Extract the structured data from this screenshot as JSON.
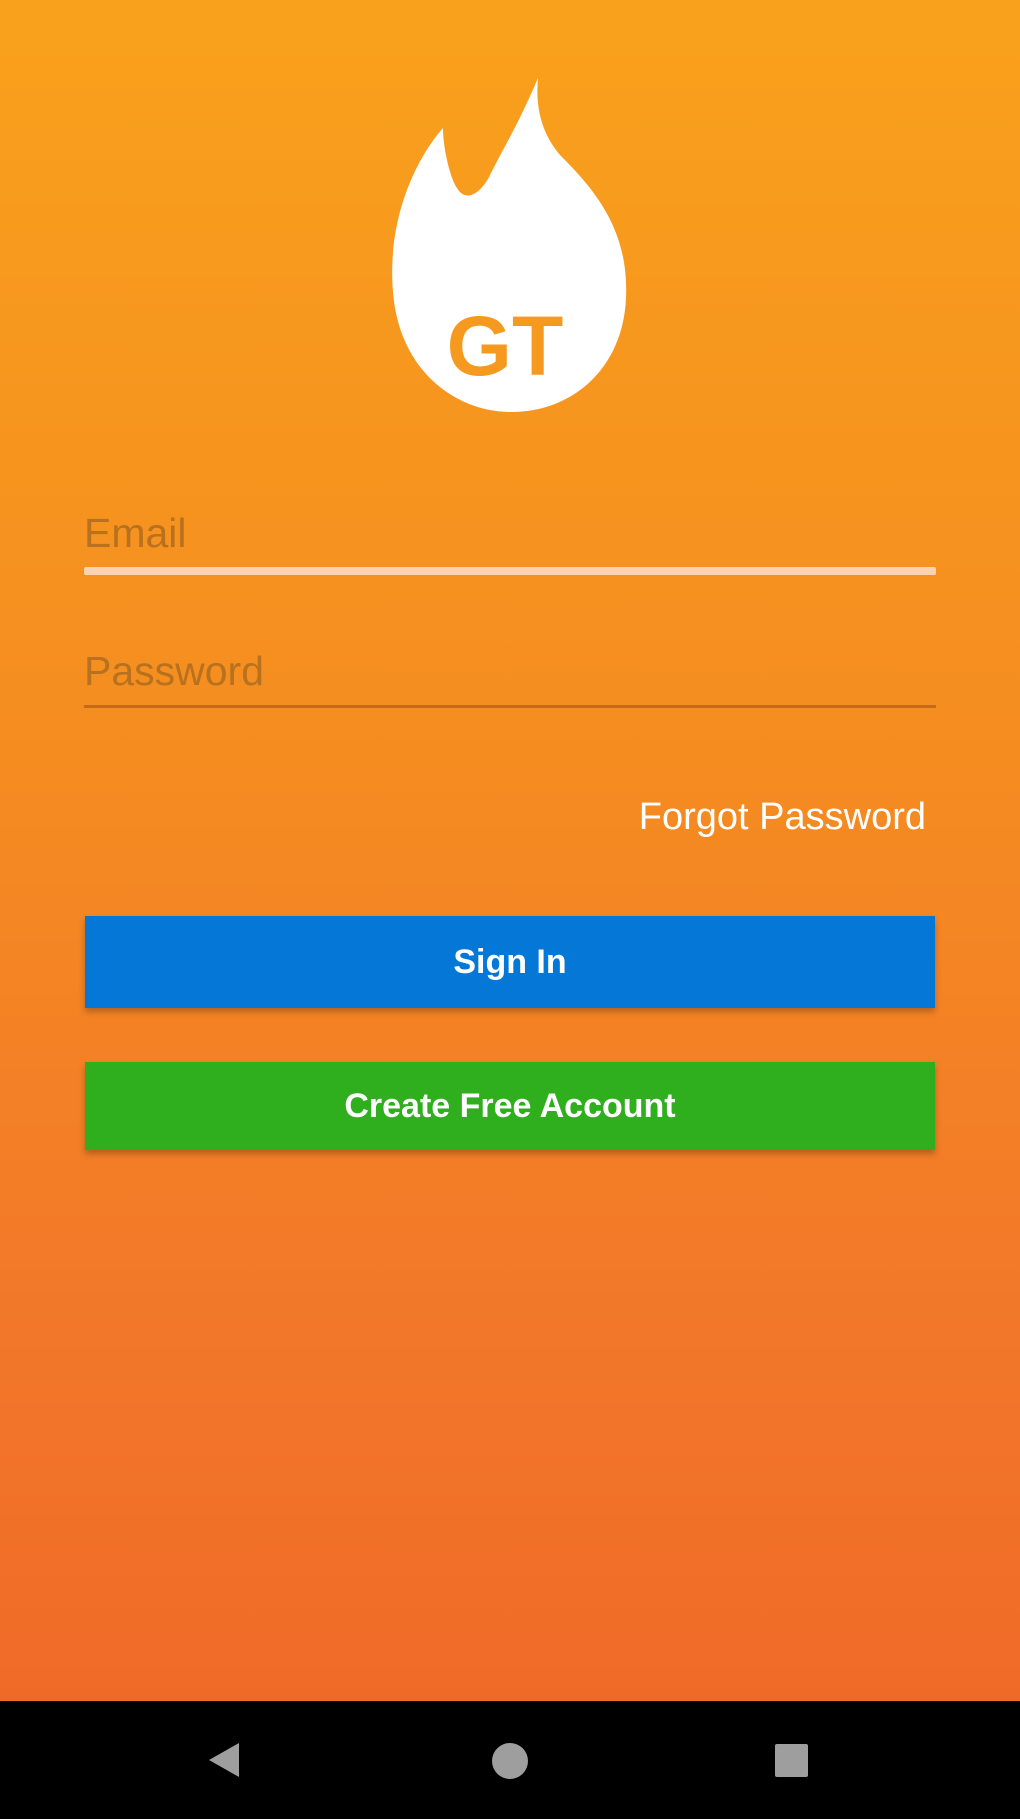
{
  "logo": {
    "text": "GT"
  },
  "login": {
    "email_placeholder": "Email",
    "password_placeholder": "Password",
    "forgot_password": "Forgot Password",
    "sign_in": "Sign In",
    "create_account": "Create Free Account"
  },
  "navigation": {
    "icons": [
      "back-icon",
      "home-icon",
      "recents-icon"
    ]
  },
  "colors": {
    "background_top": "#f9a11c",
    "background_bottom": "#ef6626",
    "sign_in_button": "#0577d6",
    "create_account_button": "#2fae1e",
    "logo_flame": "#ffffff",
    "logo_text": "#f59a1e"
  }
}
